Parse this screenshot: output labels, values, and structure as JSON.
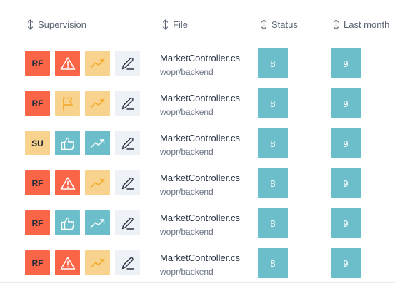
{
  "header": {
    "columns": [
      {
        "key": "supervision",
        "label": "Supervision"
      },
      {
        "key": "file",
        "label": "File"
      },
      {
        "key": "status",
        "label": "Status"
      },
      {
        "key": "last_month",
        "label": "Last month"
      }
    ]
  },
  "icons": {
    "sort": "sort-updown-icon",
    "alert": "warning-triangle-icon",
    "flag": "flag-icon",
    "thumb": "thumbs-up-icon",
    "trend": "trending-up-icon",
    "edit": "pencil-icon"
  },
  "colors": {
    "red": "#fa6548",
    "yellow": "#f8d38d",
    "teal": "#6cbfca",
    "edit_bg": "#eef1f6"
  },
  "rows": [
    {
      "code": "RF",
      "signal": "alert",
      "trend": "yellow",
      "file": "MarketController.cs",
      "path": "wopr/backend",
      "status": "8",
      "last_month": "9"
    },
    {
      "code": "RF",
      "signal": "flag",
      "trend": "yellow",
      "file": "MarketController.cs",
      "path": "wopr/backend",
      "status": "8",
      "last_month": "9"
    },
    {
      "code": "SU",
      "signal": "thumb",
      "trend": "teal",
      "file": "MarketController.cs",
      "path": "wopr/backend",
      "status": "8",
      "last_month": "9"
    },
    {
      "code": "RF",
      "signal": "alert",
      "trend": "yellow",
      "file": "MarketController.cs",
      "path": "wopr/backend",
      "status": "8",
      "last_month": "9"
    },
    {
      "code": "RF",
      "signal": "thumb",
      "trend": "teal",
      "file": "MarketController.cs",
      "path": "wopr/backend",
      "status": "8",
      "last_month": "9"
    },
    {
      "code": "RF",
      "signal": "alert",
      "trend": "yellow",
      "file": "MarketController.cs",
      "path": "wopr/backend",
      "status": "8",
      "last_month": "9"
    }
  ]
}
